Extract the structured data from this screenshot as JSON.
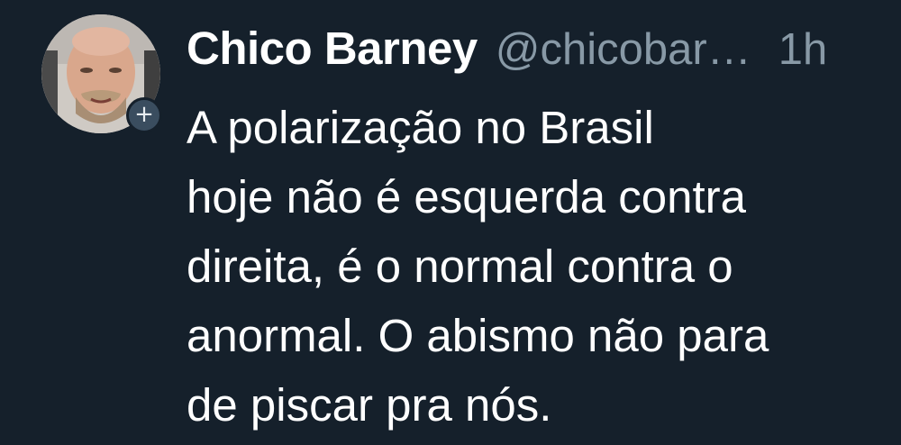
{
  "tweet": {
    "author_name": "Chico Barney",
    "handle": "@chicobar…",
    "time": "1h",
    "follow_badge": "+",
    "text_lines": [
      "A polarização no Brasil",
      "hoje não é esquerda contra",
      "direita, é o normal contra o",
      "anormal. O abismo não para",
      "de piscar pra nós."
    ]
  },
  "colors": {
    "background": "#15202b",
    "text": "#ffffff",
    "secondary_text": "#8899a6",
    "badge": "#3a4d5f"
  },
  "icons": {
    "avatar": "profile-photo",
    "follow_badge": "plus-icon"
  }
}
